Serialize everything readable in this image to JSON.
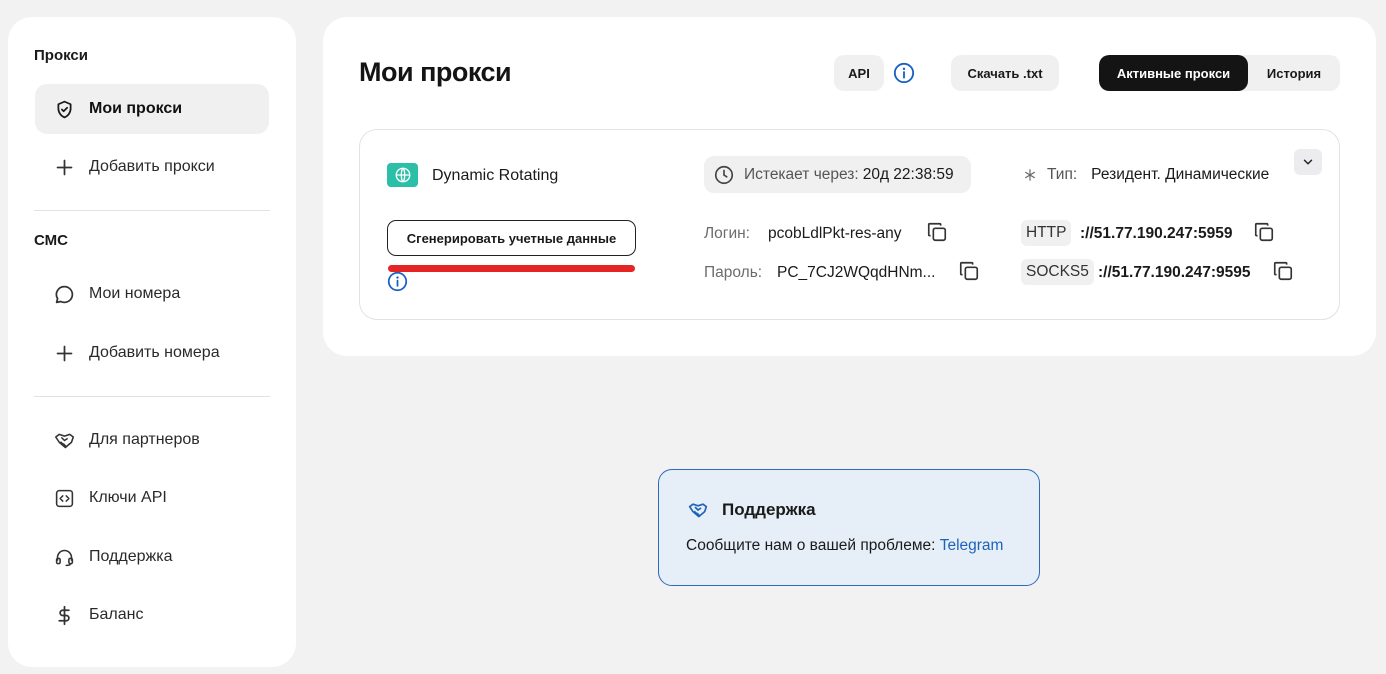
{
  "sidebar": {
    "section_proxy": "Прокси",
    "my_proxies": "Мои прокси",
    "add_proxy": "Добавить прокси",
    "section_sms": "СМС",
    "my_numbers": "Мои номера",
    "add_numbers": "Добавить номера",
    "partners": "Для партнеров",
    "api_keys": "Ключи API",
    "support": "Поддержка",
    "balance": "Баланс"
  },
  "main": {
    "title": "Мои прокси",
    "api_button": "API",
    "download_button": "Скачать .txt",
    "tabs": {
      "active": "Активные прокси",
      "history": "История"
    }
  },
  "proxy": {
    "name": "Dynamic Rotating",
    "expires_label": "Истекает через:",
    "expires_value": "20д 22:38:59",
    "type_label": "Тип:",
    "type_value": "Резидент. Динамические",
    "generate_button": "Сгенерировать учетные данные",
    "login_label": "Логин:",
    "login_value": "pcobLdlPkt-res-any",
    "password_label": "Пароль:",
    "password_value": "PC_7CJ2WQqdHNm...",
    "http_label": "HTTP",
    "http_address": "://51.77.190.247:5959",
    "socks_label": "SOCKS5",
    "socks_address": "://51.77.190.247:9595"
  },
  "support_box": {
    "title": "Поддержка",
    "message": "Сообщите нам о вашей проблеме: ",
    "link": "Telegram"
  },
  "colors": {
    "accent_teal": "#2bbfa8",
    "alert_red": "#e52424",
    "link_blue": "#1f63b8",
    "info_blue": "#1a5fc4"
  }
}
